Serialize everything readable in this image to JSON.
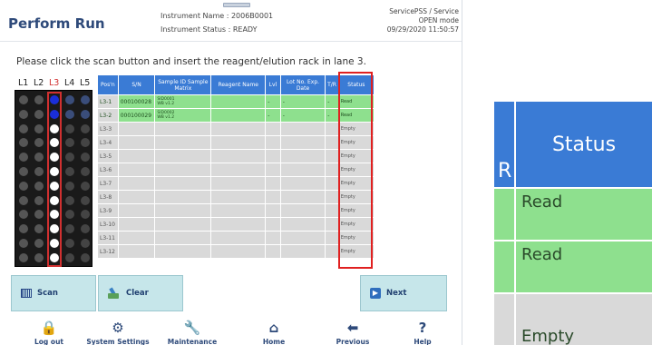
{
  "header": {
    "title": "Perform Run",
    "instrument_name": "Instrument Name : 2006B0001",
    "instrument_status": "Instrument Status : READY",
    "user": "ServicePSS / Service",
    "mode": "OPEN mode",
    "datetime": "09/29/2020 11:50:57"
  },
  "instruction": "Please click the scan button and insert the reagent/elution rack in lane 3.",
  "rack": {
    "lanes": [
      "L1",
      "L2",
      "L3",
      "L4",
      "L5"
    ]
  },
  "table": {
    "columns": [
      "Pos'n",
      "S/N",
      "Sample ID Sample Matrix",
      "Reagent Name",
      "Lvl",
      "Lot No. Exp. Date",
      "T/R",
      "Status"
    ],
    "rows": [
      {
        "pos": "L3-1",
        "sn": "000100028",
        "sample_id": "SID0001",
        "matrix": "WB v1.2",
        "reagent": "",
        "lvl": "-",
        "lot": "-",
        "tr": "-",
        "status": "Read"
      },
      {
        "pos": "L3-2",
        "sn": "000100029",
        "sample_id": "SID0002",
        "matrix": "WB v1.2",
        "reagent": "",
        "lvl": "-",
        "lot": "-",
        "tr": "-",
        "status": "Read"
      },
      {
        "pos": "L3-3",
        "sn": "",
        "sample_id": "",
        "matrix": "",
        "reagent": "",
        "lvl": "",
        "lot": "",
        "tr": "",
        "status": "Empty"
      },
      {
        "pos": "L3-4",
        "sn": "",
        "sample_id": "",
        "matrix": "",
        "reagent": "",
        "lvl": "",
        "lot": "",
        "tr": "",
        "status": "Empty"
      },
      {
        "pos": "L3-5",
        "sn": "",
        "sample_id": "",
        "matrix": "",
        "reagent": "",
        "lvl": "",
        "lot": "",
        "tr": "",
        "status": "Empty"
      },
      {
        "pos": "L3-6",
        "sn": "",
        "sample_id": "",
        "matrix": "",
        "reagent": "",
        "lvl": "",
        "lot": "",
        "tr": "",
        "status": "Empty"
      },
      {
        "pos": "L3-7",
        "sn": "",
        "sample_id": "",
        "matrix": "",
        "reagent": "",
        "lvl": "",
        "lot": "",
        "tr": "",
        "status": "Empty"
      },
      {
        "pos": "L3-8",
        "sn": "",
        "sample_id": "",
        "matrix": "",
        "reagent": "",
        "lvl": "",
        "lot": "",
        "tr": "",
        "status": "Empty"
      },
      {
        "pos": "L3-9",
        "sn": "",
        "sample_id": "",
        "matrix": "",
        "reagent": "",
        "lvl": "",
        "lot": "",
        "tr": "",
        "status": "Empty"
      },
      {
        "pos": "L3-10",
        "sn": "",
        "sample_id": "",
        "matrix": "",
        "reagent": "",
        "lvl": "",
        "lot": "",
        "tr": "",
        "status": "Empty"
      },
      {
        "pos": "L3-11",
        "sn": "",
        "sample_id": "",
        "matrix": "",
        "reagent": "",
        "lvl": "",
        "lot": "",
        "tr": "",
        "status": "Empty"
      },
      {
        "pos": "L3-12",
        "sn": "",
        "sample_id": "",
        "matrix": "",
        "reagent": "",
        "lvl": "",
        "lot": "",
        "tr": "",
        "status": "Empty"
      }
    ]
  },
  "buttons": {
    "scan": "Scan",
    "clear": "Clear",
    "next": "Next"
  },
  "nav": [
    {
      "label": "Log out",
      "icon": "lock-icon"
    },
    {
      "label": "System Settings",
      "icon": "gear-icon"
    },
    {
      "label": "Maintenance",
      "icon": "wrench-icon"
    },
    {
      "label": "Home",
      "icon": "home-icon"
    },
    {
      "label": "Previous",
      "icon": "previous-icon"
    },
    {
      "label": "Help",
      "icon": "help-icon"
    }
  ],
  "zoom": {
    "header_fragment": "R",
    "header": "Status",
    "rows": [
      "Read",
      "Read",
      "Empty"
    ]
  },
  "colors": {
    "header_blue": "#3a7bd5",
    "read_green": "#8ee08e",
    "empty_gray": "#d9d9d9",
    "highlight_red": "#e02020",
    "button_teal": "#c6e6ea"
  }
}
